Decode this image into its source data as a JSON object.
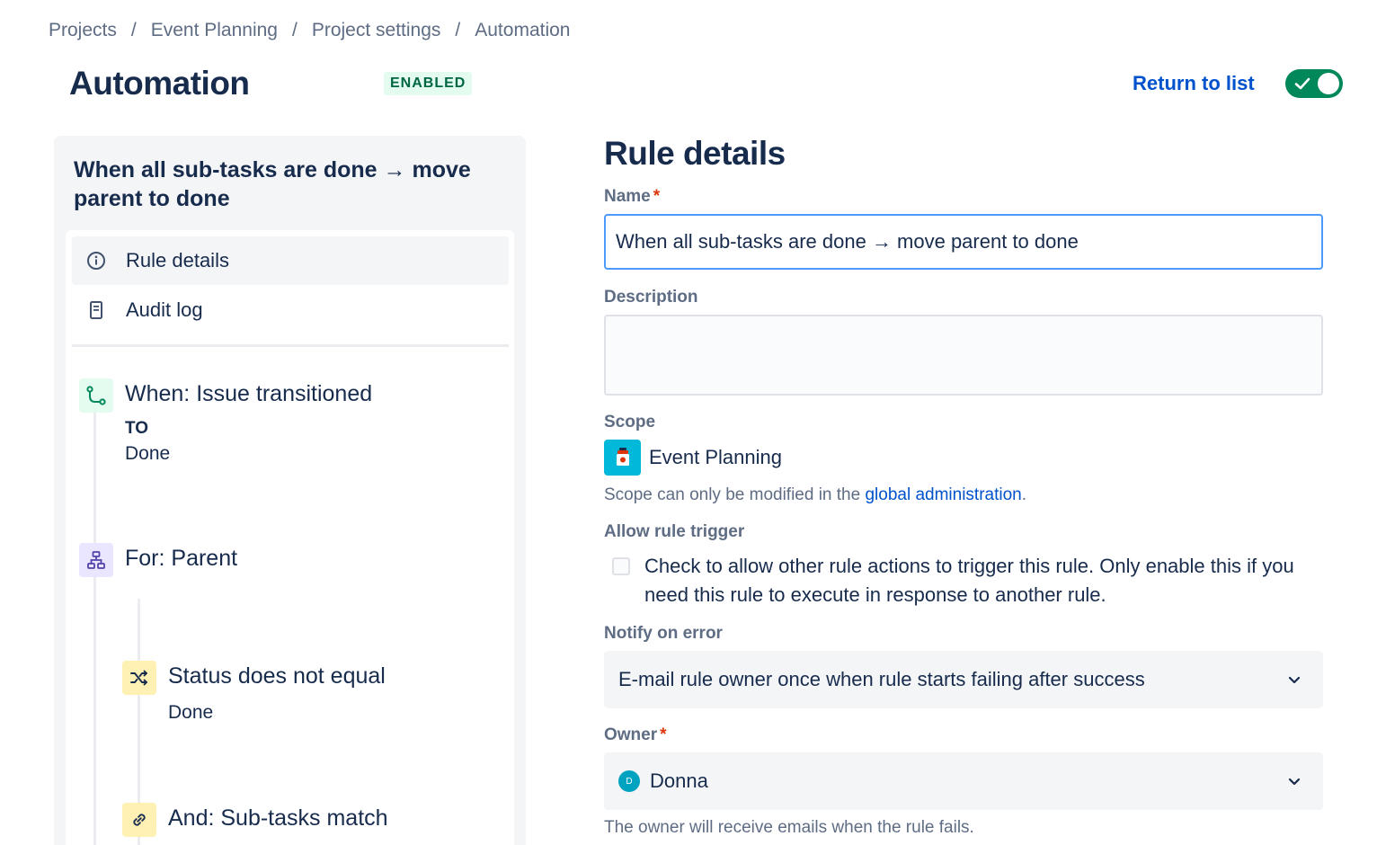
{
  "breadcrumb": {
    "items": [
      "Projects",
      "Event Planning",
      "Project settings",
      "Automation"
    ],
    "separator": "/"
  },
  "header": {
    "title": "Automation",
    "status": "ENABLED",
    "return_link": "Return to list",
    "rule_enabled": true
  },
  "sidebar": {
    "rule_title": "When all sub-tasks are done → move parent to done",
    "nav": [
      {
        "label": "Rule details",
        "icon": "info-icon",
        "active": true
      },
      {
        "label": "Audit log",
        "icon": "document-icon",
        "active": false
      }
    ],
    "components": {
      "trigger": {
        "title": "When: Issue transitioned",
        "sub_label": "TO",
        "sub_value": "Done",
        "icon": "transition-icon"
      },
      "branch": {
        "title": "For: Parent",
        "icon": "hierarchy-icon"
      },
      "condition": {
        "title": "Status does not equal",
        "sub_value": "Done",
        "icon": "shuffle-icon"
      },
      "condition2": {
        "title": "And: Sub-tasks match",
        "icon": "link-icon"
      }
    }
  },
  "details": {
    "title": "Rule details",
    "name_label": "Name",
    "name_value": "When all sub-tasks are done → move parent to done",
    "description_label": "Description",
    "description_value": "",
    "scope_label": "Scope",
    "scope_value": "Event Planning",
    "scope_help_prefix": "Scope can only be modified in the ",
    "scope_help_link": "global administration",
    "scope_help_suffix": ".",
    "allow_trigger_label": "Allow rule trigger",
    "allow_trigger_text": "Check to allow other rule actions to trigger this rule. Only enable this if you need this rule to execute in response to another rule.",
    "allow_trigger_checked": false,
    "notify_label": "Notify on error",
    "notify_value": "E-mail rule owner once when rule starts failing after success",
    "owner_label": "Owner",
    "owner_value": "Donna",
    "owner_initial": "D",
    "owner_help": "The owner will receive emails when the rule fails."
  },
  "colors": {
    "accent": "#0052cc",
    "toggle_on": "#00875a",
    "lozenge_bg": "#e3fcef",
    "lozenge_text": "#006644",
    "required": "#de350b",
    "focus_border": "#4c9aff"
  }
}
